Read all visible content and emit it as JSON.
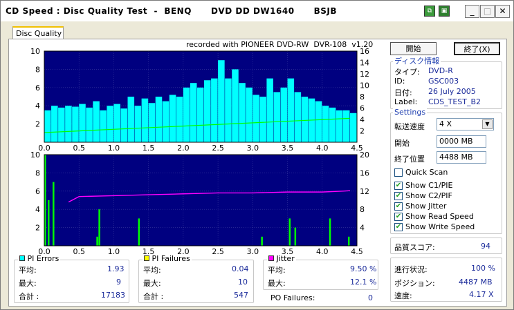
{
  "window": {
    "title": "CD Speed : Disc Quality Test  -  BENQ      DVD DD DW1640      BSJB",
    "min_glyph": "_",
    "max_glyph": "□",
    "close_glyph": "✕"
  },
  "tab": {
    "label": "Disc Quality"
  },
  "recorded_with": "recorded with PIONEER DVD-RW  DVR-108  v1.20",
  "buttons": {
    "start": "開始",
    "stop": "終了(X)"
  },
  "disc_info": {
    "title": "ディスク情報",
    "type_label": "タイプ:",
    "type_value": "DVD-R",
    "id_label": "ID:",
    "id_value": "GSC003",
    "date_label": "日付:",
    "date_value": "26 July 2005",
    "label_label": "Label:",
    "label_value": "CDS_TEST_B2"
  },
  "settings": {
    "title": "Settings",
    "speed_label": "転送速度",
    "speed_value": "4 X",
    "start_label": "開始",
    "start_value": "0000 MB",
    "end_label": "終了位置",
    "end_value": "4488 MB",
    "quick_scan": "Quick Scan",
    "show_c1": "Show C1/PIE",
    "show_c2": "Show C2/PIF",
    "show_jitter": "Show Jitter",
    "show_read": "Show Read Speed",
    "show_write": "Show Write Speed"
  },
  "quality": {
    "label": "品質スコア:",
    "value": "94"
  },
  "progress": {
    "progress_label": "進行状況:",
    "progress_value": "100 %",
    "position_label": "ポジション:",
    "position_value": "4487 MB",
    "speed_label": "速度:",
    "speed_value": "4.17 X"
  },
  "pi_errors": {
    "title": "PI Errors",
    "avg_label": "平均:",
    "avg": "1.93",
    "max_label": "最大:",
    "max": "9",
    "total_label": "合計 :",
    "total": "17183"
  },
  "pi_failures": {
    "title": "PI Failures",
    "avg_label": "平均:",
    "avg": "0.04",
    "max_label": "最大:",
    "max": "10",
    "total_label": "合計 :",
    "total": "547"
  },
  "jitter": {
    "title": "Jitter",
    "avg_label": "平均:",
    "avg": "9.50 %",
    "max_label": "最大:",
    "max": "12.1 %"
  },
  "po_failures": {
    "label": "PO Failures:",
    "value": "0"
  },
  "colors": {
    "pie": "#00ffff",
    "pif": "#00ff00",
    "jitter": "#ff00ff",
    "chart_bg": "#000080",
    "read_speed": "#00ff00"
  },
  "chart_data": [
    {
      "type": "bar",
      "name": "PI Errors",
      "x_ticks": [
        "0.0",
        "0.5",
        "1.0",
        "1.5",
        "2.0",
        "2.5",
        "3.0",
        "3.5",
        "4.0",
        "4.5"
      ],
      "y_left_ticks": [
        "2",
        "4",
        "6",
        "8",
        "10"
      ],
      "y_right_ticks": [
        "2",
        "4",
        "6",
        "8",
        "10",
        "12",
        "14",
        "16"
      ],
      "xlim": [
        0,
        4.5
      ],
      "ylim": [
        0,
        10
      ],
      "y2lim": [
        0,
        16
      ],
      "grid": true,
      "pie_x": [
        0.0,
        0.1,
        0.2,
        0.3,
        0.4,
        0.5,
        0.6,
        0.7,
        0.8,
        0.9,
        1.0,
        1.1,
        1.2,
        1.3,
        1.4,
        1.5,
        1.6,
        1.7,
        1.8,
        1.9,
        2.0,
        2.1,
        2.2,
        2.3,
        2.4,
        2.5,
        2.6,
        2.7,
        2.8,
        2.9,
        3.0,
        3.1,
        3.2,
        3.3,
        3.4,
        3.5,
        3.6,
        3.7,
        3.8,
        3.9,
        4.0,
        4.1,
        4.2,
        4.3,
        4.4
      ],
      "pie_values": [
        3.5,
        4,
        3.8,
        4,
        3.9,
        4.2,
        3.8,
        4.5,
        3.5,
        4,
        4.2,
        3.7,
        5,
        4,
        4.8,
        4.3,
        5,
        4.5,
        5.2,
        5,
        6,
        6.5,
        6,
        6.8,
        7,
        9,
        7,
        8,
        6.5,
        6,
        5.2,
        5,
        7,
        5.5,
        6,
        7,
        5.5,
        5,
        4.8,
        4.5,
        4,
        3.8,
        3.5,
        3.5,
        3.2
      ],
      "read_speed_x": [
        0,
        4.4
      ],
      "read_speed": [
        1.7,
        4.2
      ]
    },
    {
      "type": "bar",
      "name": "PI Failures / Jitter",
      "x_ticks": [
        "0.0",
        "0.5",
        "1.0",
        "1.5",
        "2.0",
        "2.5",
        "3.0",
        "3.5",
        "4.0",
        "4.5"
      ],
      "y_left_ticks": [
        "2",
        "4",
        "6",
        "8",
        "10"
      ],
      "y_right_ticks": [
        "4",
        "8",
        "12",
        "16",
        "20"
      ],
      "xlim": [
        0,
        4.5
      ],
      "ylim": [
        0,
        10
      ],
      "y2lim": [
        0,
        20
      ],
      "grid": true,
      "pif_x": [
        0.0,
        0.05,
        0.12,
        0.75,
        0.78,
        1.35,
        3.12,
        3.52,
        3.6,
        4.1,
        4.37
      ],
      "pif_values": [
        10,
        5,
        7,
        1,
        4,
        3,
        1,
        3,
        2,
        3,
        1
      ],
      "jitter_x": [
        0.35,
        0.5,
        1.0,
        1.5,
        2.0,
        2.5,
        3.0,
        3.5,
        4.0,
        4.3,
        4.4
      ],
      "jitter_values": [
        9.6,
        10.8,
        11.0,
        11.2,
        11.4,
        11.6,
        11.6,
        11.8,
        11.8,
        12.0,
        12.1
      ]
    }
  ]
}
